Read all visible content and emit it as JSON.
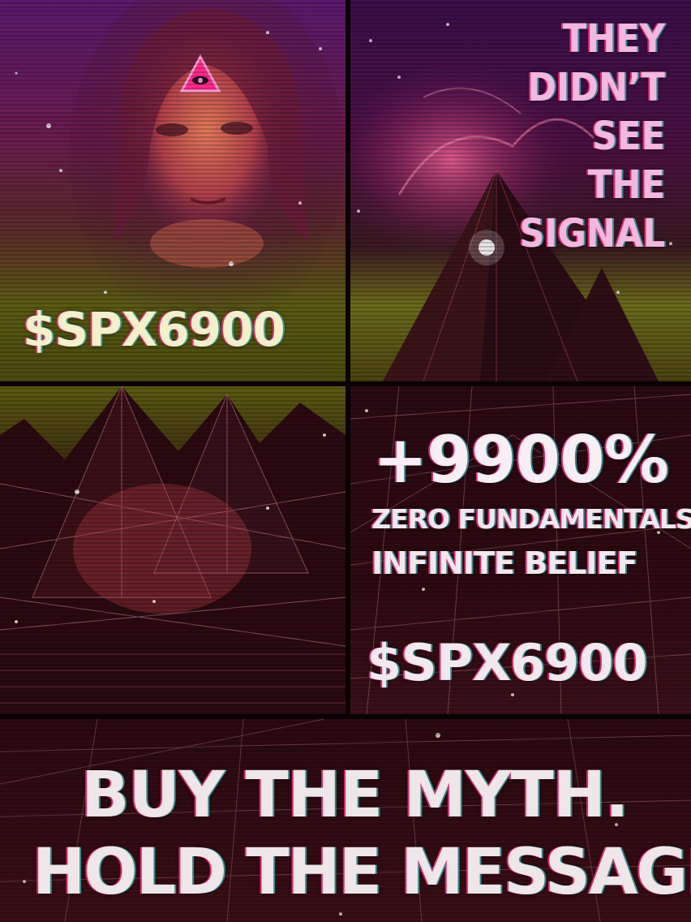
{
  "poster": {
    "ticker_top": "$SPX6900",
    "tagline": [
      "THEY",
      "DIDN’T",
      "SEE",
      "THE",
      "SIGNAL"
    ],
    "gain": "+9900%",
    "sub_line_1": "ZERO FUNDAMENTALS",
    "sub_line_2": "INFINITE BELIEF",
    "ticker_mid": "$SPX6900",
    "slogan_line_1": "BUY THE MYTH.",
    "slogan_line_2": "HOLD THE MESSAGE."
  },
  "images": {
    "panel_1": "woman-portrait-with-glowing-eye-triangle",
    "panel_2": "dark-pyramid-with-pink-nebula",
    "panel_3": "wireframe-pyramids-with-figure",
    "panel_4": "wireframe-grid-landscape",
    "panel_5": "wireframe-grid-floor"
  },
  "colors": {
    "accent_pink": "#ff2a8a",
    "text_cream": "#f4f0cc",
    "text_pink": "#f2b8e0",
    "text_white": "#f2e8ee"
  }
}
